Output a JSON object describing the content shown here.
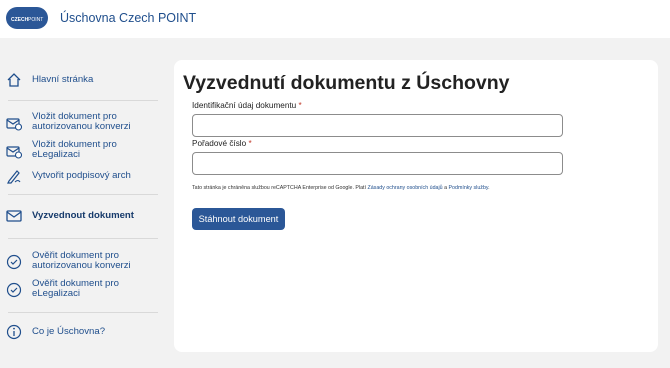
{
  "header": {
    "logo_text_1": "CZECH",
    "logo_text_2": "POINT",
    "title": "Úschovna Czech POINT"
  },
  "sidebar": {
    "items": [
      {
        "label": "Hlavní stránka",
        "icon": "home-icon"
      },
      {
        "label": "Vložit dokument pro autorizovanou konverzi",
        "icon": "mail-upload-icon"
      },
      {
        "label": "Vložit dokument pro eLegalizaci",
        "icon": "mail-upload-icon"
      },
      {
        "label": "Vytvořit podpisový arch",
        "icon": "pen-signature-icon"
      },
      {
        "label": "Vyzvednout dokument",
        "icon": "envelope-icon",
        "active": true
      },
      {
        "label": "Ověřit dokument pro autorizovanou konverzi",
        "icon": "check-circle-icon"
      },
      {
        "label": "Ověřit dokument pro eLegalizaci",
        "icon": "check-circle-icon"
      },
      {
        "label": "Co je Úschovna?",
        "icon": "info-icon"
      }
    ]
  },
  "main": {
    "title": "Vyzvednutí dokumentu z Úschovny",
    "field_id_label": "Identifikační údaj dokumentu",
    "field_id_value": "",
    "field_order_label": "Pořadové číslo",
    "field_order_value": "",
    "required_mark": "*",
    "notice_prefix": "Tato stránka je chráněna službou reCAPTCHA Enterprise od Google. Platí",
    "notice_link_1": "Zásady ochrany osobních údajů",
    "notice_mid": "a",
    "notice_link_2": "Podmínky služby",
    "notice_suffix": ".",
    "submit_label": "Stáhnout dokument"
  },
  "colors": {
    "brand_blue": "#2b5797",
    "link_blue": "#1f4e8c",
    "background": "#f2f2f2"
  }
}
